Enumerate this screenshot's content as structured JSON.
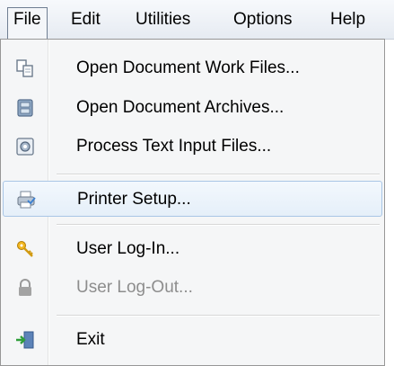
{
  "menubar": {
    "items": [
      {
        "label": "File"
      },
      {
        "label": "Edit"
      },
      {
        "label": "Utilities"
      },
      {
        "label": "Options"
      },
      {
        "label": "Help"
      }
    ]
  },
  "file_menu": {
    "items": [
      {
        "label": "Open Document  Work Files...",
        "icon": "copy-documents-icon"
      },
      {
        "label": "Open Document  Archives...",
        "icon": "archive-cabinet-icon"
      },
      {
        "label": "Process Text Input Files...",
        "icon": "process-file-icon"
      },
      {
        "label": "Printer Setup...",
        "icon": "printer-icon"
      },
      {
        "label": "User Log-In...",
        "icon": "keys-icon"
      },
      {
        "label": "User Log-Out...",
        "icon": "padlock-icon",
        "disabled": true
      },
      {
        "label": "Exit",
        "icon": "exit-door-icon"
      }
    ],
    "highlighted_item": "Printer Setup..."
  }
}
